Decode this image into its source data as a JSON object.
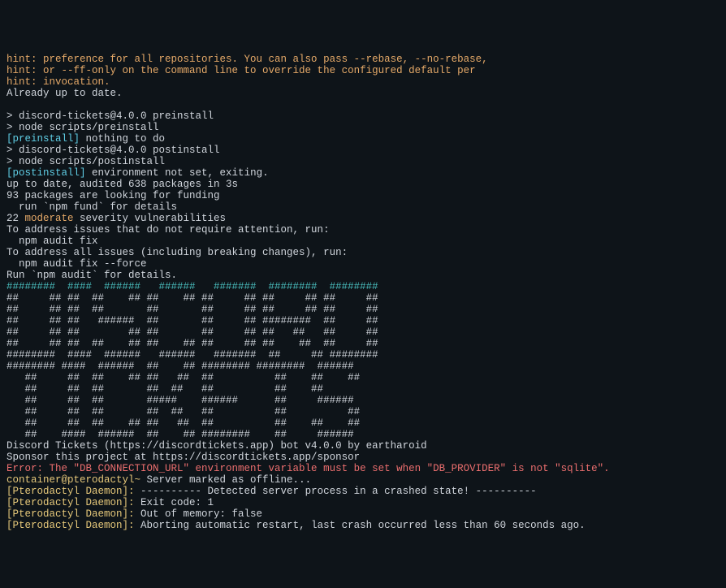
{
  "lines": [
    {
      "segments": [
        {
          "text": "hint: preference for all repositories. You can also pass --rebase, --no-rebase,",
          "class": "orange"
        }
      ]
    },
    {
      "segments": [
        {
          "text": "hint: or --ff-only on the command line to override the configured default per",
          "class": "orange"
        }
      ]
    },
    {
      "segments": [
        {
          "text": "hint: invocation.",
          "class": "orange"
        }
      ]
    },
    {
      "segments": [
        {
          "text": "Already up to date.",
          "class": "white"
        }
      ]
    },
    {
      "segments": [
        {
          "text": "",
          "class": ""
        }
      ]
    },
    {
      "segments": [
        {
          "text": "> discord-tickets@4.0.0 preinstall",
          "class": "white"
        }
      ]
    },
    {
      "segments": [
        {
          "text": "> node scripts/preinstall",
          "class": "white"
        }
      ]
    },
    {
      "segments": [
        {
          "text": "[preinstall]",
          "class": "cyan"
        },
        {
          "text": " nothing to do",
          "class": "white"
        }
      ]
    },
    {
      "segments": [
        {
          "text": "> discord-tickets@4.0.0 postinstall",
          "class": "white"
        }
      ]
    },
    {
      "segments": [
        {
          "text": "> node scripts/postinstall",
          "class": "white"
        }
      ]
    },
    {
      "segments": [
        {
          "text": "[postinstall]",
          "class": "cyan"
        },
        {
          "text": " environment not set, exiting.",
          "class": "white"
        }
      ]
    },
    {
      "segments": [
        {
          "text": "up to date, audited 638 packages in 3s",
          "class": "white"
        }
      ]
    },
    {
      "segments": [
        {
          "text": "93 packages are looking for funding",
          "class": "white"
        }
      ]
    },
    {
      "segments": [
        {
          "text": "  run `npm fund` for details",
          "class": "white"
        }
      ]
    },
    {
      "segments": [
        {
          "text": "22 ",
          "class": "white"
        },
        {
          "text": "moderate",
          "class": "orange"
        },
        {
          "text": " severity vulnerabilities",
          "class": "white"
        }
      ]
    },
    {
      "segments": [
        {
          "text": "To address issues that do not require attention, run:",
          "class": "white"
        }
      ]
    },
    {
      "segments": [
        {
          "text": "  npm audit fix",
          "class": "white"
        }
      ]
    },
    {
      "segments": [
        {
          "text": "To address all issues (including breaking changes), run:",
          "class": "white"
        }
      ]
    },
    {
      "segments": [
        {
          "text": "  npm audit fix --force",
          "class": "white"
        }
      ]
    },
    {
      "segments": [
        {
          "text": "Run `npm audit` for details.",
          "class": "white"
        }
      ]
    },
    {
      "segments": [
        {
          "text": "########  ####  ######   ######   #######  ########  ######## ",
          "class": "teal"
        }
      ]
    },
    {
      "segments": [
        {
          "text": "##     ## ##  ##    ## ##    ## ##     ## ##     ## ##     ##",
          "class": "white"
        }
      ]
    },
    {
      "segments": [
        {
          "text": "##     ## ##  ##       ##       ##     ## ##     ## ##     ##",
          "class": "white"
        }
      ]
    },
    {
      "segments": [
        {
          "text": "##     ## ##   ######  ##       ##     ## ########  ##     ##",
          "class": "white"
        }
      ]
    },
    {
      "segments": [
        {
          "text": "##     ## ##        ## ##       ##     ## ##   ##   ##     ##",
          "class": "white"
        }
      ]
    },
    {
      "segments": [
        {
          "text": "##     ## ##  ##    ## ##    ## ##     ## ##    ##  ##     ##",
          "class": "white"
        }
      ]
    },
    {
      "segments": [
        {
          "text": "########  ####  ######   ######   #######  ##     ## ######## ",
          "class": "white"
        }
      ]
    },
    {
      "segments": [
        {
          "text": "######## ####  ######  ##    ## ######## ########  ######  ",
          "class": "white"
        }
      ]
    },
    {
      "segments": [
        {
          "text": "   ##     ##  ##    ## ##   ##  ##          ##    ##    ## ",
          "class": "white"
        }
      ]
    },
    {
      "segments": [
        {
          "text": "   ##     ##  ##       ##  ##   ##          ##    ##       ",
          "class": "white"
        }
      ]
    },
    {
      "segments": [
        {
          "text": "   ##     ##  ##       #####    ######      ##     ######  ",
          "class": "white"
        }
      ]
    },
    {
      "segments": [
        {
          "text": "   ##     ##  ##       ##  ##   ##          ##          ## ",
          "class": "white"
        }
      ]
    },
    {
      "segments": [
        {
          "text": "   ##     ##  ##    ## ##   ##  ##          ##    ##    ## ",
          "class": "white"
        }
      ]
    },
    {
      "segments": [
        {
          "text": "   ##    ####  ######  ##    ## ########    ##     ######  ",
          "class": "white"
        }
      ]
    },
    {
      "segments": [
        {
          "text": "Discord Tickets (https://discordtickets.app) bot v4.0.0 by eartharoid",
          "class": "white"
        }
      ]
    },
    {
      "segments": [
        {
          "text": "Sponsor this project at https://discordtickets.app/sponsor",
          "class": "white"
        }
      ]
    },
    {
      "segments": [
        {
          "text": "Error: The \"DB_CONNECTION_URL\" environment variable must be set when \"DB_PROVIDER\" is not \"sqlite\".",
          "class": "red"
        }
      ]
    },
    {
      "segments": [
        {
          "text": "container@pterodactyl~",
          "class": "yellow"
        },
        {
          "text": " Server marked as offline...",
          "class": "white"
        }
      ]
    },
    {
      "segments": [
        {
          "text": "[Pterodactyl Daemon]:",
          "class": "yellow"
        },
        {
          "text": " ---------- Detected server process in a crashed state! ----------",
          "class": "white"
        }
      ]
    },
    {
      "segments": [
        {
          "text": "[Pterodactyl Daemon]:",
          "class": "yellow"
        },
        {
          "text": " Exit code: 1",
          "class": "white"
        }
      ]
    },
    {
      "segments": [
        {
          "text": "[Pterodactyl Daemon]:",
          "class": "yellow"
        },
        {
          "text": " Out of memory: false",
          "class": "white"
        }
      ]
    },
    {
      "segments": [
        {
          "text": "[Pterodactyl Daemon]:",
          "class": "yellow"
        },
        {
          "text": " Aborting automatic restart, last crash occurred less than 60 seconds ago.",
          "class": "white"
        }
      ]
    }
  ]
}
